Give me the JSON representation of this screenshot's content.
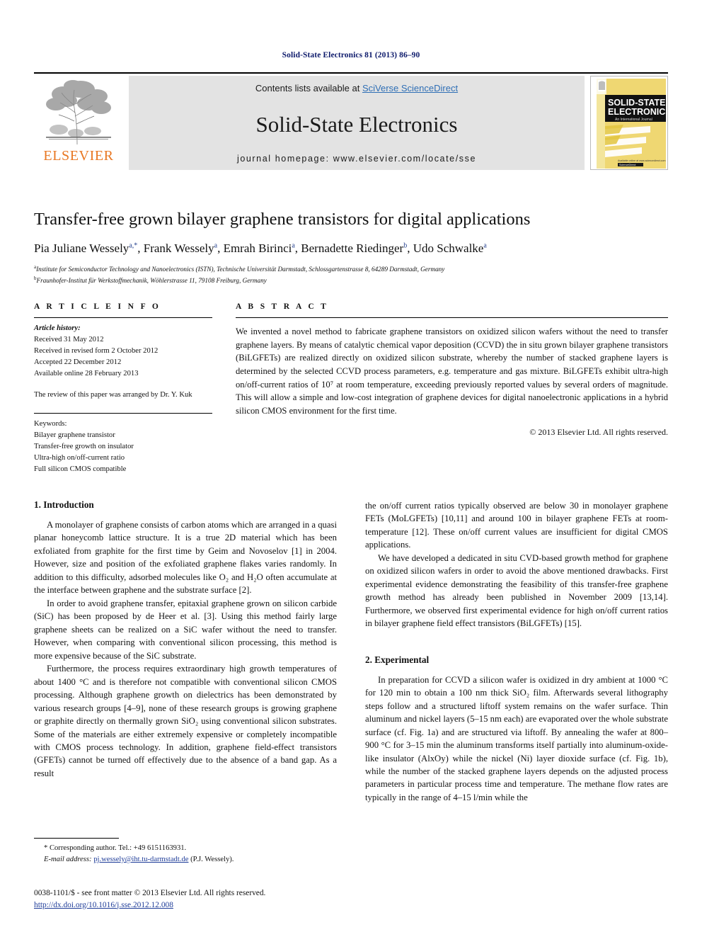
{
  "running_head": "Solid-State Electronics 81 (2013) 86–90",
  "masthead": {
    "publisher_logo_text": "ELSEVIER",
    "contents_prefix": "Contents lists available at ",
    "contents_link": "SciVerse ScienceDirect",
    "journal_name": "Solid-State Electronics",
    "homepage": "journal homepage: www.elsevier.com/locate/sse",
    "cover": {
      "line1": "SOLID-STATE",
      "line2": "ELECTRONICS",
      "subtitle": "An International Journal",
      "footer": "Available online at www.sciencedirect.com"
    }
  },
  "title": "Transfer-free grown bilayer graphene transistors for digital applications",
  "authors": [
    {
      "name": "Pia Juliane Wessely",
      "marks": "a,*"
    },
    {
      "name": "Frank Wessely",
      "marks": "a"
    },
    {
      "name": "Emrah Birinci",
      "marks": "a"
    },
    {
      "name": "Bernadette Riedinger",
      "marks": "b"
    },
    {
      "name": "Udo Schwalke",
      "marks": "a"
    }
  ],
  "affiliations": [
    {
      "mark": "a",
      "text": "Institute for Semiconductor Technology and Nanoelectronics (ISTN), Technische Universität Darmstadt, Schlossgartenstrasse 8, 64289 Darmstadt, Germany"
    },
    {
      "mark": "b",
      "text": "Fraunhofer-Institut für Werkstoffmechanik, Wöhlerstrasse 11, 79108 Freiburg, Germany"
    }
  ],
  "article_info": {
    "heading": "A R T I C L E   I N F O",
    "history_label": "Article history:",
    "history": [
      "Received 31 May 2012",
      "Received in revised form 2 October 2012",
      "Accepted 22 December 2012",
      "Available online 28 February 2013"
    ],
    "editor_note": "The review of this paper was arranged by Dr. Y. Kuk",
    "keywords_label": "Keywords:",
    "keywords": [
      "Bilayer graphene transistor",
      "Transfer-free growth on insulator",
      "Ultra-high on/off-current ratio",
      "Full silicon CMOS compatible"
    ]
  },
  "abstract": {
    "heading": "A B S T R A C T",
    "text": "We invented a novel method to fabricate graphene transistors on oxidized silicon wafers without the need to transfer graphene layers. By means of catalytic chemical vapor deposition (CCVD) the in situ grown bilayer graphene transistors (BiLGFETs) are realized directly on oxidized silicon substrate, whereby the number of stacked graphene layers is determined by the selected CCVD process parameters, e.g. temperature and gas mixture. BiLGFETs exhibit ultra-high on/off-current ratios of 10⁷ at room temperature, exceeding previously reported values by several orders of magnitude. This will allow a simple and low-cost integration of graphene devices for digital nanoelectronic applications in a hybrid silicon CMOS environment for the first time.",
    "copyright": "© 2013 Elsevier Ltd. All rights reserved."
  },
  "sections": {
    "introduction_heading": "1. Introduction",
    "experimental_heading": "2. Experimental"
  },
  "left_column_paragraphs": [
    "A monolayer of graphene consists of carbon atoms which are arranged in a quasi planar honeycomb lattice structure. It is a true 2D material which has been exfoliated from graphite for the first time by Geim and Novoselov [1] in 2004. However, size and position of the exfoliated graphene flakes varies randomly. In addition to this difficulty, adsorbed molecules like O₂ and H₂O often accumulate at the interface between graphene and the substrate surface [2].",
    "In order to avoid graphene transfer, epitaxial graphene grown on silicon carbide (SiC) has been proposed by de Heer et al. [3]. Using this method fairly large graphene sheets can be realized on a SiC wafer without the need to transfer. However, when comparing with conventional silicon processing, this method is more expensive because of the SiC substrate.",
    "Furthermore, the process requires extraordinary high growth temperatures of about 1400 °C and is therefore not compatible with conventional silicon CMOS processing. Although graphene growth on dielectrics has been demonstrated by various research groups [4–9], none of these research groups is growing graphene or graphite directly on thermally grown SiO₂ using conventional silicon substrates. Some of the materials are either extremely expensive or completely incompatible with CMOS process technology. In addition, graphene field-effect transistors (GFETs) cannot be turned off effectively due to the absence of a band gap. As a result"
  ],
  "right_column_paragraphs": [
    "the on/off current ratios typically observed are below 30 in monolayer graphene FETs (MoLGFETs) [10,11] and around 100 in bilayer graphene FETs at room-temperature [12]. These on/off current values are insufficient for digital CMOS applications.",
    "We have developed a dedicated in situ CVD-based growth method for graphene on oxidized silicon wafers in order to avoid the above mentioned drawbacks. First experimental evidence demonstrating the feasibility of this transfer-free graphene growth method has already been published in November 2009 [13,14]. Furthermore, we observed first experimental evidence for high on/off current ratios in bilayer graphene field effect transistors (BiLGFETs) [15]."
  ],
  "experimental_paragraph": "In preparation for CCVD a silicon wafer is oxidized in dry ambient at 1000 °C for 120 min to obtain a 100 nm thick SiO₂ film. Afterwards several lithography steps follow and a structured liftoff system remains on the wafer surface. Thin aluminum and nickel layers (5–15 nm each) are evaporated over the whole substrate surface (cf. Fig. 1a) and are structured via liftoff. By annealing the wafer at 800–900 °C for 3–15 min the aluminum transforms itself partially into aluminum-oxide-like insulator (AlxOy) while the nickel (Ni) layer dioxide surface (cf. Fig. 1b), while the number of the stacked graphene layers depends on the adjusted process parameters in particular process time and temperature. The methane flow rates are typically in the range of 4–15 l/min while the",
  "footnotes": {
    "corresponding": "* Corresponding author. Tel.: +49 6151163931.",
    "email_label": "E-mail address:",
    "email": "pj.wessely@iht.tu-darmstadt.de",
    "email_suffix": "(P.J. Wessely)."
  },
  "imprint": {
    "line1": "0038-1101/$ - see front matter © 2013 Elsevier Ltd. All rights reserved.",
    "doi": "http://dx.doi.org/10.1016/j.sse.2012.12.008"
  },
  "colors": {
    "running_head": "#0d1a6b",
    "elsevier_orange": "#e87722",
    "link_blue": "#1f3d99",
    "sciencedirect_blue": "#2f6fb5",
    "band_gray": "#e3e3e3",
    "cover_yellow": "#efd772"
  }
}
